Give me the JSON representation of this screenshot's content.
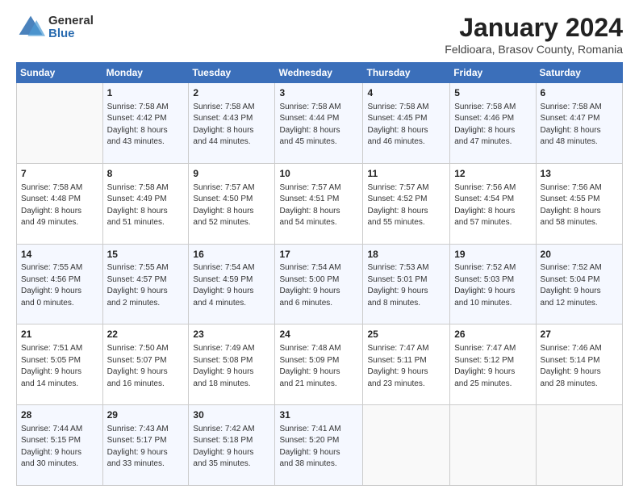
{
  "logo": {
    "general": "General",
    "blue": "Blue"
  },
  "title": "January 2024",
  "subtitle": "Feldioara, Brasov County, Romania",
  "weekdays": [
    "Sunday",
    "Monday",
    "Tuesday",
    "Wednesday",
    "Thursday",
    "Friday",
    "Saturday"
  ],
  "weeks": [
    [
      {
        "day": "",
        "info": ""
      },
      {
        "day": "1",
        "info": "Sunrise: 7:58 AM\nSunset: 4:42 PM\nDaylight: 8 hours\nand 43 minutes."
      },
      {
        "day": "2",
        "info": "Sunrise: 7:58 AM\nSunset: 4:43 PM\nDaylight: 8 hours\nand 44 minutes."
      },
      {
        "day": "3",
        "info": "Sunrise: 7:58 AM\nSunset: 4:44 PM\nDaylight: 8 hours\nand 45 minutes."
      },
      {
        "day": "4",
        "info": "Sunrise: 7:58 AM\nSunset: 4:45 PM\nDaylight: 8 hours\nand 46 minutes."
      },
      {
        "day": "5",
        "info": "Sunrise: 7:58 AM\nSunset: 4:46 PM\nDaylight: 8 hours\nand 47 minutes."
      },
      {
        "day": "6",
        "info": "Sunrise: 7:58 AM\nSunset: 4:47 PM\nDaylight: 8 hours\nand 48 minutes."
      }
    ],
    [
      {
        "day": "7",
        "info": "Sunrise: 7:58 AM\nSunset: 4:48 PM\nDaylight: 8 hours\nand 49 minutes."
      },
      {
        "day": "8",
        "info": "Sunrise: 7:58 AM\nSunset: 4:49 PM\nDaylight: 8 hours\nand 51 minutes."
      },
      {
        "day": "9",
        "info": "Sunrise: 7:57 AM\nSunset: 4:50 PM\nDaylight: 8 hours\nand 52 minutes."
      },
      {
        "day": "10",
        "info": "Sunrise: 7:57 AM\nSunset: 4:51 PM\nDaylight: 8 hours\nand 54 minutes."
      },
      {
        "day": "11",
        "info": "Sunrise: 7:57 AM\nSunset: 4:52 PM\nDaylight: 8 hours\nand 55 minutes."
      },
      {
        "day": "12",
        "info": "Sunrise: 7:56 AM\nSunset: 4:54 PM\nDaylight: 8 hours\nand 57 minutes."
      },
      {
        "day": "13",
        "info": "Sunrise: 7:56 AM\nSunset: 4:55 PM\nDaylight: 8 hours\nand 58 minutes."
      }
    ],
    [
      {
        "day": "14",
        "info": "Sunrise: 7:55 AM\nSunset: 4:56 PM\nDaylight: 9 hours\nand 0 minutes."
      },
      {
        "day": "15",
        "info": "Sunrise: 7:55 AM\nSunset: 4:57 PM\nDaylight: 9 hours\nand 2 minutes."
      },
      {
        "day": "16",
        "info": "Sunrise: 7:54 AM\nSunset: 4:59 PM\nDaylight: 9 hours\nand 4 minutes."
      },
      {
        "day": "17",
        "info": "Sunrise: 7:54 AM\nSunset: 5:00 PM\nDaylight: 9 hours\nand 6 minutes."
      },
      {
        "day": "18",
        "info": "Sunrise: 7:53 AM\nSunset: 5:01 PM\nDaylight: 9 hours\nand 8 minutes."
      },
      {
        "day": "19",
        "info": "Sunrise: 7:52 AM\nSunset: 5:03 PM\nDaylight: 9 hours\nand 10 minutes."
      },
      {
        "day": "20",
        "info": "Sunrise: 7:52 AM\nSunset: 5:04 PM\nDaylight: 9 hours\nand 12 minutes."
      }
    ],
    [
      {
        "day": "21",
        "info": "Sunrise: 7:51 AM\nSunset: 5:05 PM\nDaylight: 9 hours\nand 14 minutes."
      },
      {
        "day": "22",
        "info": "Sunrise: 7:50 AM\nSunset: 5:07 PM\nDaylight: 9 hours\nand 16 minutes."
      },
      {
        "day": "23",
        "info": "Sunrise: 7:49 AM\nSunset: 5:08 PM\nDaylight: 9 hours\nand 18 minutes."
      },
      {
        "day": "24",
        "info": "Sunrise: 7:48 AM\nSunset: 5:09 PM\nDaylight: 9 hours\nand 21 minutes."
      },
      {
        "day": "25",
        "info": "Sunrise: 7:47 AM\nSunset: 5:11 PM\nDaylight: 9 hours\nand 23 minutes."
      },
      {
        "day": "26",
        "info": "Sunrise: 7:47 AM\nSunset: 5:12 PM\nDaylight: 9 hours\nand 25 minutes."
      },
      {
        "day": "27",
        "info": "Sunrise: 7:46 AM\nSunset: 5:14 PM\nDaylight: 9 hours\nand 28 minutes."
      }
    ],
    [
      {
        "day": "28",
        "info": "Sunrise: 7:44 AM\nSunset: 5:15 PM\nDaylight: 9 hours\nand 30 minutes."
      },
      {
        "day": "29",
        "info": "Sunrise: 7:43 AM\nSunset: 5:17 PM\nDaylight: 9 hours\nand 33 minutes."
      },
      {
        "day": "30",
        "info": "Sunrise: 7:42 AM\nSunset: 5:18 PM\nDaylight: 9 hours\nand 35 minutes."
      },
      {
        "day": "31",
        "info": "Sunrise: 7:41 AM\nSunset: 5:20 PM\nDaylight: 9 hours\nand 38 minutes."
      },
      {
        "day": "",
        "info": ""
      },
      {
        "day": "",
        "info": ""
      },
      {
        "day": "",
        "info": ""
      }
    ]
  ]
}
